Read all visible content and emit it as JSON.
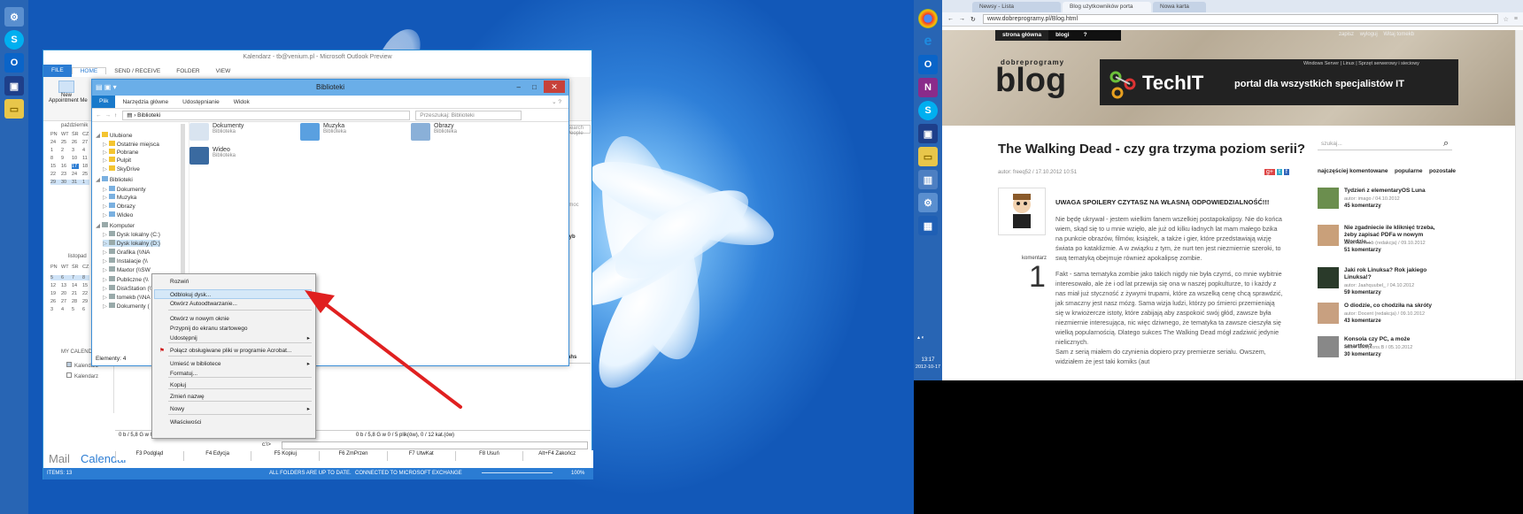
{
  "outlook": {
    "title": "Kalendarz - tb@venium.pl - Microsoft Outlook Preview",
    "tabs": [
      "FILE",
      "HOME",
      "SEND / RECEIVE",
      "FOLDER",
      "VIEW"
    ],
    "ribbon_new_label": "New",
    "ribbon_new_sub": "Appointment Me",
    "search_placeholder": "Search People",
    "month1": "październik",
    "month2": "listopad",
    "day_headers": [
      "PN",
      "WT",
      "ŚR",
      "CZ"
    ],
    "weeks1": [
      [
        "24",
        "25",
        "26",
        "27"
      ],
      [
        "1",
        "2",
        "3",
        "4"
      ],
      [
        "8",
        "9",
        "10",
        "11"
      ],
      [
        "15",
        "16",
        "17",
        "18"
      ],
      [
        "22",
        "23",
        "24",
        "25"
      ],
      [
        "29",
        "30",
        "31",
        "1"
      ]
    ],
    "weeks2": [
      [
        "",
        "",
        "",
        ""
      ],
      [
        "5",
        "6",
        "7",
        "8"
      ],
      [
        "12",
        "13",
        "14",
        "15"
      ],
      [
        "19",
        "20",
        "21",
        "22"
      ],
      [
        "26",
        "27",
        "28",
        "29"
      ],
      [
        "3",
        "4",
        "5",
        "6"
      ]
    ],
    "my_calendars": "MY CALENDARS",
    "cal_item1": "Kalendarz",
    "cal_item2": "Kalendarz",
    "bottom_mail": "Mail",
    "bottom_cal": "Calendar",
    "status_items": "ITEMS: 13",
    "status_folders": "ALL FOLDERS ARE UP TO DATE.",
    "status_conn": "CONNECTED TO MICROSOFT EXCHANGE",
    "status_zoom": "100%",
    "right_col_labels": [
      "Szuk",
      "omoc",
      "byb",
      "fahs",
      "fahs",
      "fahs",
      "fahs",
      "fahs"
    ]
  },
  "explorer": {
    "title": "Biblioteki",
    "tabs": [
      "Plik",
      "Narzędzia główne",
      "Udostępnianie",
      "Widok"
    ],
    "address": "Biblioteki",
    "search_placeholder": "Przeszukaj: Biblioteki",
    "tree": [
      "Ulubione",
      "Ostatnie miejsca",
      "Pobrane",
      "Pulpit",
      "SkyDrive",
      "Biblioteki",
      "Dokumenty",
      "Muzyka",
      "Obrazy",
      "Wideo",
      "Komputer",
      "Dysk lokalny (C:)",
      "Dysk lokalny (D:)",
      "Grafika (\\\\NA",
      "Instalacje (\\\\",
      "Maxtor (\\\\SW",
      "Publiczne (\\\\",
      "DiskStation (\\\\",
      "tomekb (\\\\NA",
      "Dokumenty ("
    ],
    "items": [
      {
        "name": "Dokumenty",
        "sub": "Biblioteka"
      },
      {
        "name": "Muzyka",
        "sub": "Biblioteka"
      },
      {
        "name": "Obrazy",
        "sub": "Biblioteka"
      },
      {
        "name": "Wideo",
        "sub": "Biblioteka"
      }
    ],
    "status": "Elementy: 4"
  },
  "context_menu": {
    "items": [
      "Rozwiń",
      "Odblokuj dysk...",
      "Otwórz Autoodtwarzanie...",
      "Otwórz w nowym oknie",
      "Przypnij do ekranu startowego",
      "Udostępnij",
      "Połącz obsługiwane pliki w programie Acrobat...",
      "Umieść w bibliotece",
      "Formatuj...",
      "Kopiuj",
      "Zmień nazwę",
      "Nowy",
      "Właściwości"
    ]
  },
  "totalcmd": {
    "status_left": "0 b / 5,8 G w 0 / 5 plik(ów), 0 / 12 kat.(ów)",
    "status_right": "0 b / 5,8 G w 0 / 5 plik(ów), 0 / 12 kat.(ów)",
    "cmd_prefix": "c:\\>",
    "fkeys": [
      "F3 Podgląd",
      "F4 Edycja",
      "F5 Kopiuj",
      "F6 ZmPrzen",
      "F7 UtwKat",
      "F8 Usuń",
      "Alt+F4 Zakończ"
    ]
  },
  "clock": {
    "time": "13:17",
    "date": "2012-10-17"
  },
  "chrome": {
    "tabs": [
      "Newsy - Lista",
      "Blog użytkowników porta",
      "Nowa karta"
    ],
    "url": "www.dobreprogramy.pl/Blog.html"
  },
  "site": {
    "nav": [
      "strona główna",
      "blogi",
      "?"
    ],
    "logo_small": "dobreprogramy",
    "logo_big": "blog",
    "banner_brand": "TechIT",
    "banner_tagline": "portal dla wszystkich specjalistów IT",
    "banner_top": "Windows Server | Linux | Sprzęt serwerowy i sieciowy",
    "header_links": [
      "zapisz",
      "wyloguj",
      "Witaj tomekb"
    ],
    "article_title": "The Walking Dead - czy gra trzyma poziom serii?",
    "article_meta": "autor: freeq52 / 17.10.2012 10:51",
    "comments_label": "komentarz",
    "comments_count": "1",
    "warning": "UWAGA SPOILERY CZYTASZ NA WŁASNĄ ODPOWIEDZIALNOŚĆ!!!",
    "para1": "Nie będę ukrywał - jestem wielkim fanem wszelkiej postapokalipsy. Nie do końca wiem, skąd się to u mnie wzięło, ale już od kilku ładnych lat mam małego bzika na punkcie obrazów, filmów, książek, a także i gier, które przedstawiają wizję świata po kataklizmie. A w związku z tym, że nurt ten jest niezmiernie szeroki, to swą tematyką obejmuje również apokalipsę zombie.",
    "para2": "Fakt - sama tematyka zombie jako takich nigdy nie była czymś, co mnie wybitnie interesowało, ale że i od lat przewija się ona w naszej popkulturze, to i każdy z nas miał już styczność z żywymi trupami, które za wszelką cenę chcą sprawdzić, jak smaczny jest nasz mózg. Sama wizja ludzi, którzy po śmierci przemieniają się w krwiożercze istoty, które zabijają aby zaspokoić swój głód, zawsze była niezmiernie interesująca, nic więc dziwnego, że tematyka ta zawsze cieszyła się wielką popularnością. Dlatego sukces The Walking Dead mógł zadziwić jedynie nielicznych.",
    "para3": "Sam z serią miałem do czynienia dopiero przy premierze serialu. Owszem, widziałem że jest taki komiks (aut",
    "search_placeholder": "szukaj...",
    "side_tabs": [
      "najczęściej komentowane",
      "popularne",
      "pozostałe"
    ],
    "side_entries": [
      {
        "title": "Tydzień z elementaryOS Luna",
        "meta": "autor: imago / 04.10.2012",
        "count": "45 komentarzy"
      },
      {
        "title": "Nie zgadniecie ile kliknięć trzeba, żeby zapisać PDFa w nowym Wordzie...",
        "meta": "autor: tomekb (redakcja) / 09.10.2012",
        "count": "51 komentarzy"
      },
      {
        "title": "Jaki rok Linuksa? Rok jakiego Linuksa!?",
        "meta": "autor: Jaahquubel_ / 04.10.2012",
        "count": "59 komentarzy"
      },
      {
        "title": "O diodzie, co chodziła na skróty",
        "meta": "autor: Docent (redakcja) / 09.10.2012",
        "count": "43 komentarze"
      },
      {
        "title": "Konsola czy PC, a może smartfon?",
        "meta": "autor: Scorpions.B / 05.10.2012",
        "count": "30 komentarzy"
      }
    ]
  },
  "colors": {
    "accent": "#2b7cd3",
    "arrow": "#e02020",
    "titlebar": "#6aaee8"
  }
}
